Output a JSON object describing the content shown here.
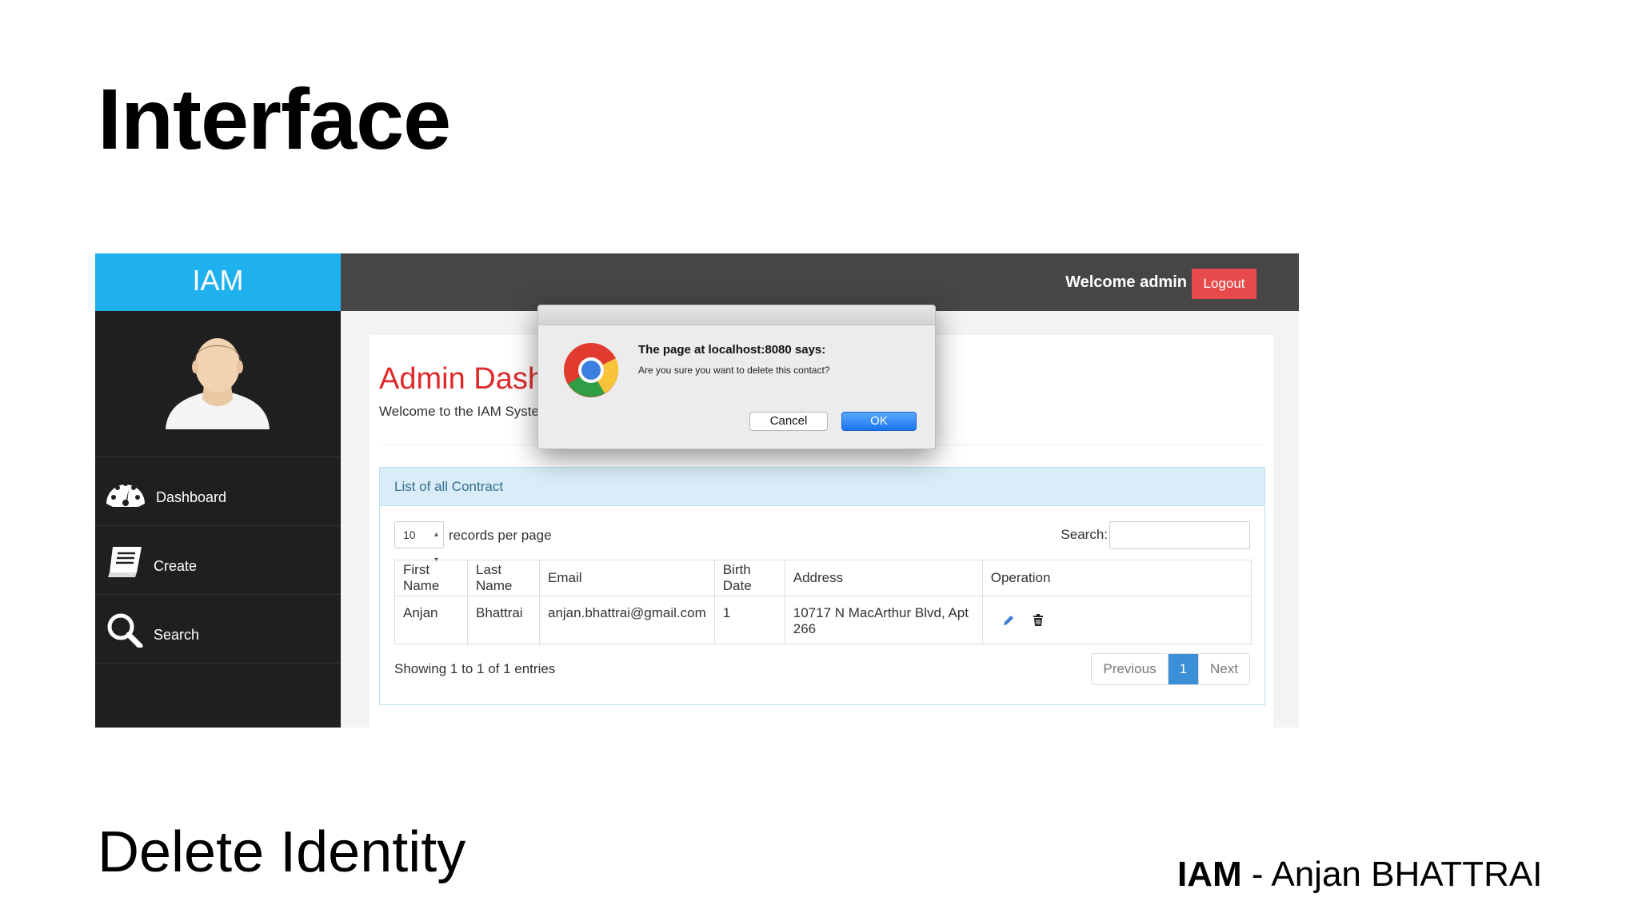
{
  "slide": {
    "title": "Interface",
    "subtitle": "Delete Identity",
    "footer_brand": "IAM",
    "footer_sep": " - ",
    "footer_author": "Anjan BHATTRAI"
  },
  "app": {
    "brand": "IAM",
    "welcome": "Welcome admin",
    "logout": "Logout",
    "nav": [
      {
        "label": "Dashboard",
        "icon": "dashboard-gauge-icon"
      },
      {
        "label": "Create",
        "icon": "book-icon"
      },
      {
        "label": "Search",
        "icon": "magnifier-icon"
      }
    ],
    "page_title": "Admin Dash",
    "page_subtitle": "Welcome to the IAM Syste",
    "panel_title": "List of all Contract",
    "length_value": "10",
    "length_label": "records per page",
    "search_label": "Search:",
    "table": {
      "headers": [
        "First Name",
        "Last Name",
        "Email",
        "Birth Date",
        "Address",
        "Operation"
      ],
      "rows": [
        [
          "Anjan",
          "Bhattrai",
          "anjan.bhattrai@gmail.com",
          "1",
          "10717 N MacArthur Blvd, Apt 266"
        ]
      ]
    },
    "info": "Showing 1 to 1 of 1 entries",
    "pager": {
      "prev": "Previous",
      "current": "1",
      "next": "Next"
    }
  },
  "dialog": {
    "title": "The page at localhost:8080 says:",
    "message": "Are you sure you want to delete this contact?",
    "cancel": "Cancel",
    "ok": "OK"
  },
  "colors": {
    "brand_bar": "#1fb1ee",
    "sidebar": "#1f1f1f",
    "topbar": "#464646",
    "logout": "#e64a4a",
    "page_title": "#e02a2a",
    "panel_head": "#d9ecf8",
    "pager_active": "#3a8fd6",
    "ok_button": "#1b74f0"
  }
}
